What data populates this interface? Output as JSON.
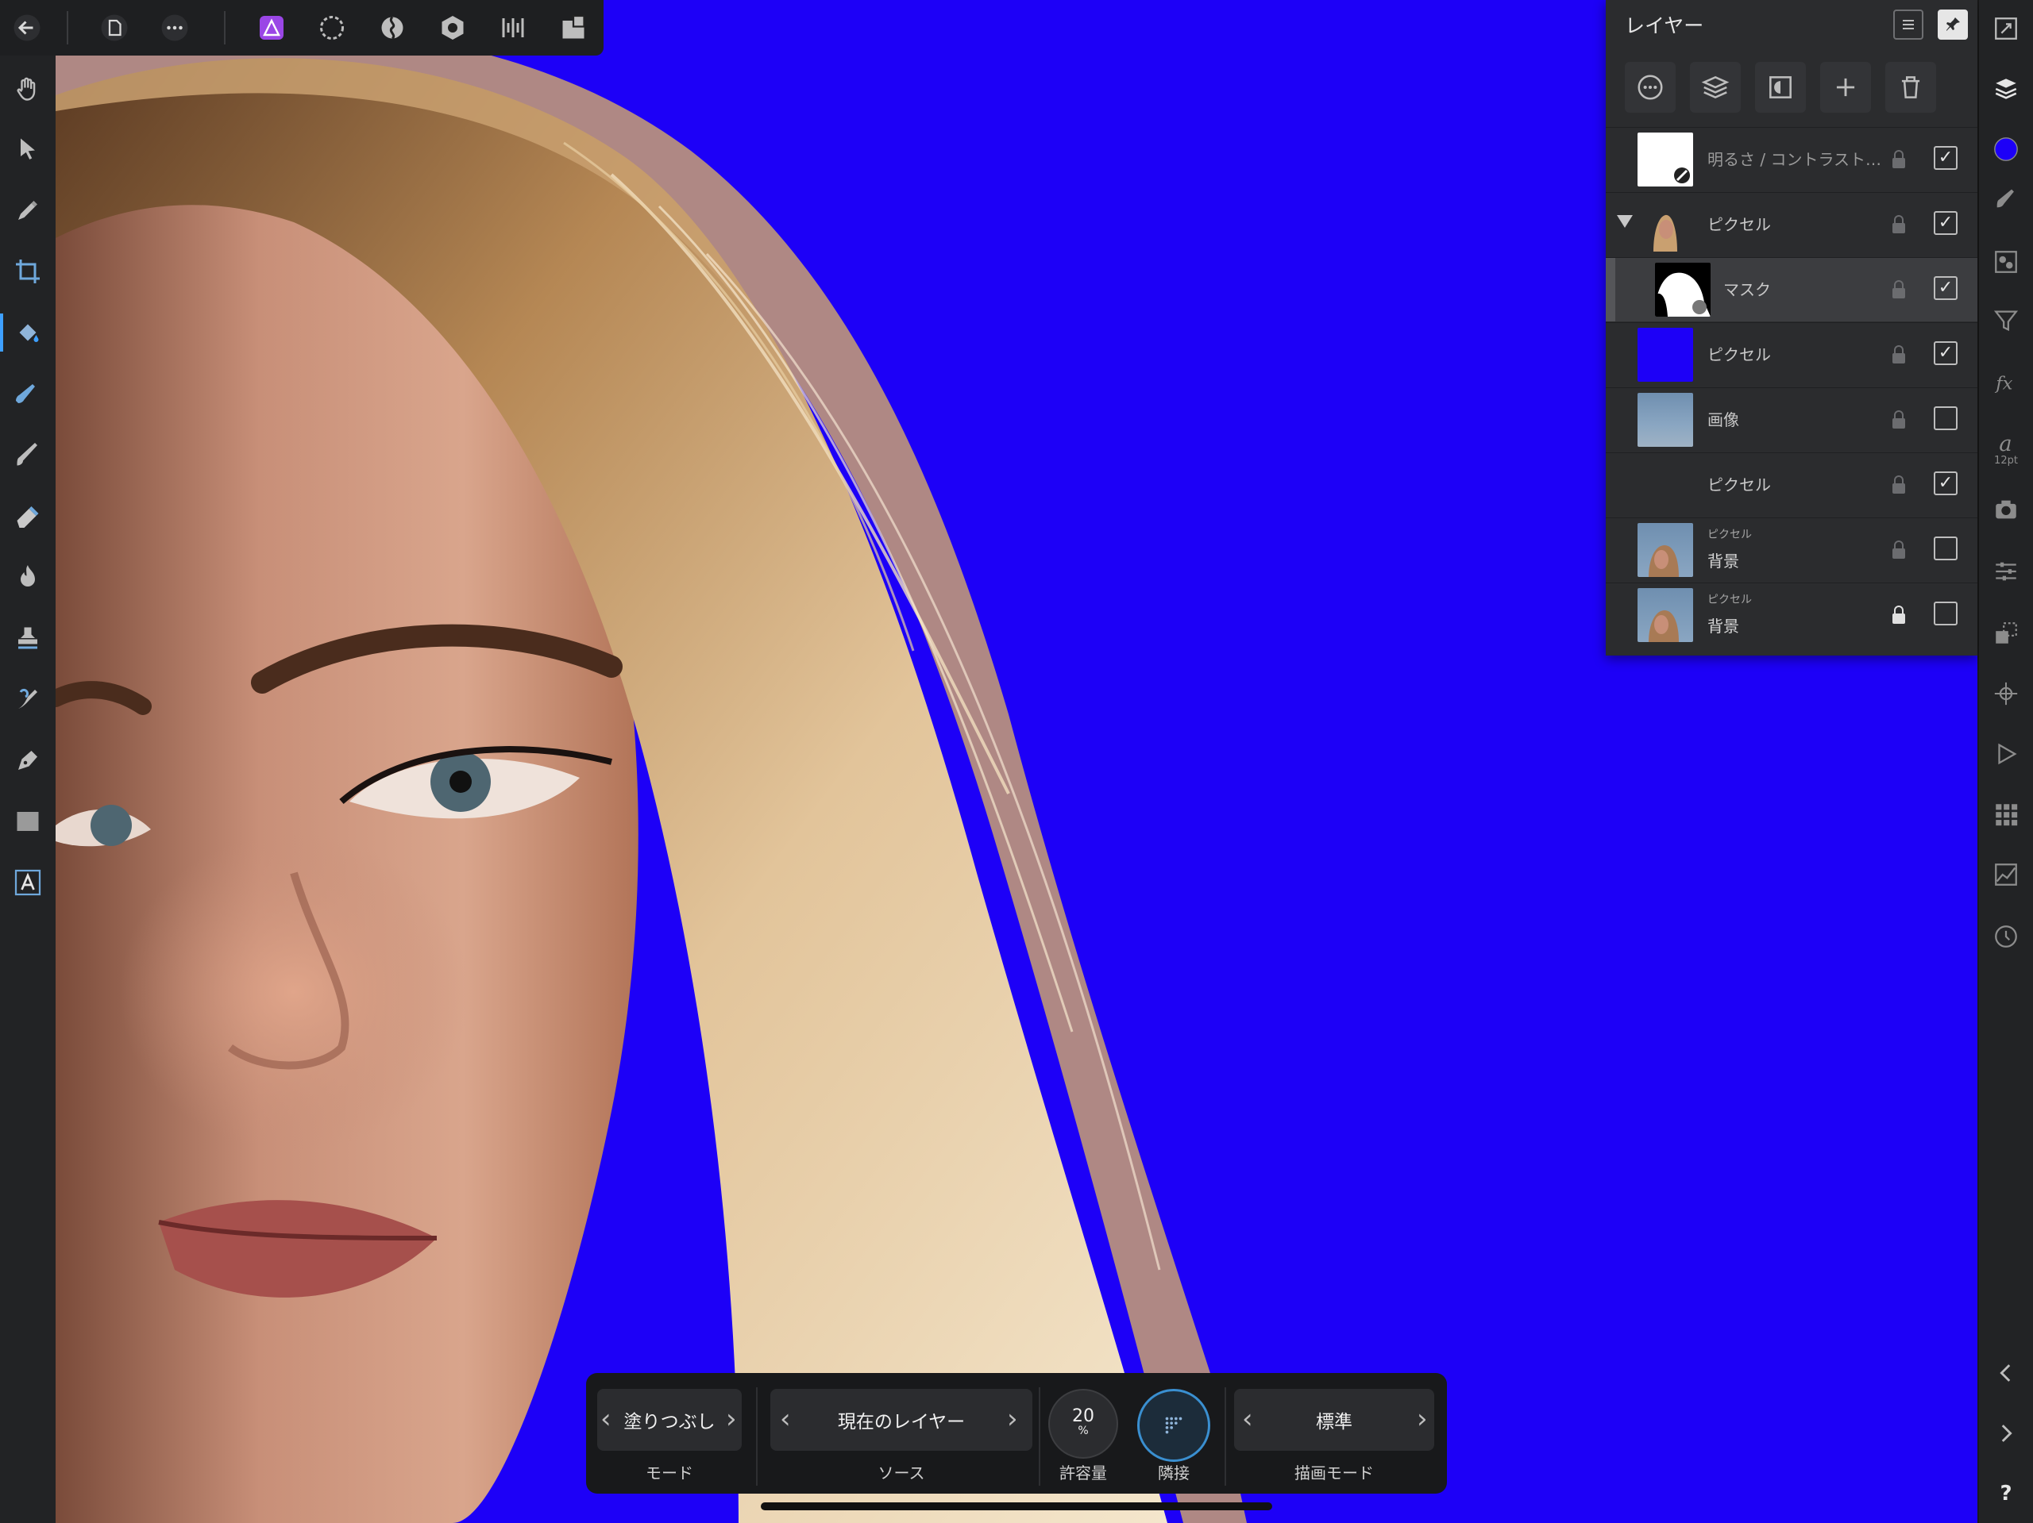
{
  "colors": {
    "canvas_bg": "#1d00f7",
    "accent": "#3ea0ff",
    "persona_purple": "#9a46e6",
    "primary_color": "#1d00f7"
  },
  "top_toolbar": {
    "icons": [
      "back-arrow-icon",
      "document-icon",
      "more-icon",
      "photo-persona-icon",
      "selection-persona-icon",
      "liquify-persona-icon",
      "develop-persona-icon",
      "tone-mapping-persona-icon",
      "export-persona-icon"
    ]
  },
  "left_toolbar": {
    "tools": [
      "hand-tool",
      "move-tool",
      "color-picker-tool",
      "crop-tool",
      "flood-fill-tool",
      "selection-brush-tool",
      "paint-brush-tool",
      "erase-tool",
      "dodge-burn-tool",
      "clone-tool",
      "healing-tool",
      "pen-tool",
      "rectangle-tool",
      "text-tool"
    ],
    "active_tool": "flood-fill-tool"
  },
  "layers_panel": {
    "title": "レイヤー",
    "layers": [
      {
        "name": "明るさ / コントラスト…",
        "type": "adjustment",
        "locked": false,
        "visible": true
      },
      {
        "name": "ピクセル",
        "type": "pixel-group",
        "locked": false,
        "visible": true,
        "expanded": true
      },
      {
        "name": "マスク",
        "type": "mask",
        "locked": false,
        "visible": true,
        "selected": true
      },
      {
        "name": "ピクセル",
        "type": "pixel-fill",
        "locked": false,
        "visible": true
      },
      {
        "name": "画像",
        "type": "image",
        "locked": false,
        "visible": false
      },
      {
        "name": "ピクセル",
        "type": "pixel-empty",
        "locked": false,
        "visible": true
      },
      {
        "name": "背景",
        "kind": "ピクセル",
        "type": "background",
        "locked": false,
        "visible": false
      },
      {
        "name": "背景",
        "kind": "ピクセル",
        "type": "background",
        "locked": true,
        "visible": false
      }
    ]
  },
  "right_bar": {
    "icons": [
      "navigator-icon",
      "layers-icon",
      "color-swatch",
      "brushes-icon",
      "channels-icon",
      "filter-icon",
      "fx-icon",
      "text-style-icon",
      "camera-icon",
      "adjustments-icon",
      "transform-icon",
      "snapping-icon",
      "play-icon",
      "grid-icon",
      "histogram-icon",
      "history-icon",
      "collapse-left-icon",
      "collapse-right-icon",
      "help-icon"
    ],
    "text_size": "12pt",
    "help": "?"
  },
  "context_toolbar": {
    "mode": {
      "value": "塗りつぶし",
      "label": "モード"
    },
    "source": {
      "value": "現在のレイヤー",
      "label": "ソース"
    },
    "tolerance": {
      "value": "20",
      "unit": "%",
      "label": "許容量"
    },
    "contiguous": {
      "label": "隣接",
      "enabled": true
    },
    "blend_mode": {
      "value": "標準",
      "label": "描画モード"
    }
  }
}
